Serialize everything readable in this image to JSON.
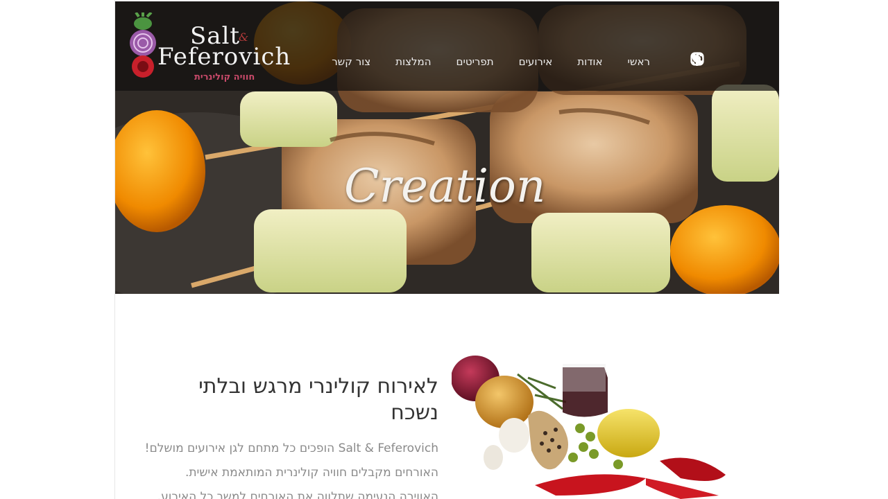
{
  "logo": {
    "line1": "Salt",
    "amp": "&",
    "line2": "Feferovich",
    "subtitle": "חוויה קולינרית"
  },
  "nav": {
    "items": [
      {
        "label": "ראשי"
      },
      {
        "label": "אודות"
      },
      {
        "label": "אירועים"
      },
      {
        "label": "תפריטים"
      },
      {
        "label": "המלצות"
      },
      {
        "label": "צור קשר"
      }
    ]
  },
  "social": {
    "icons": [
      "whatsapp-icon",
      "phone-icon",
      "instagram-icon",
      "facebook-icon"
    ]
  },
  "hero": {
    "title": "Creation"
  },
  "intro": {
    "heading": "לאירוח קולינרי מרגש ובלתי נשכח",
    "paragraphs": [
      "Salt & Feferovich הופכים כל מתחם לגן אירועים מושלם!",
      "האורחים מקבלים חוויה קולינרית המותאמת אישית.",
      "האווירה הנעימה שתלווה את האורחים למשך כל האירוע."
    ]
  },
  "colors": {
    "nav_bg": "#12100f",
    "nav_text": "#eeeeee",
    "heading": "#333333",
    "body_text": "#8a8a8a",
    "logo_accent": "#c94a6a"
  }
}
